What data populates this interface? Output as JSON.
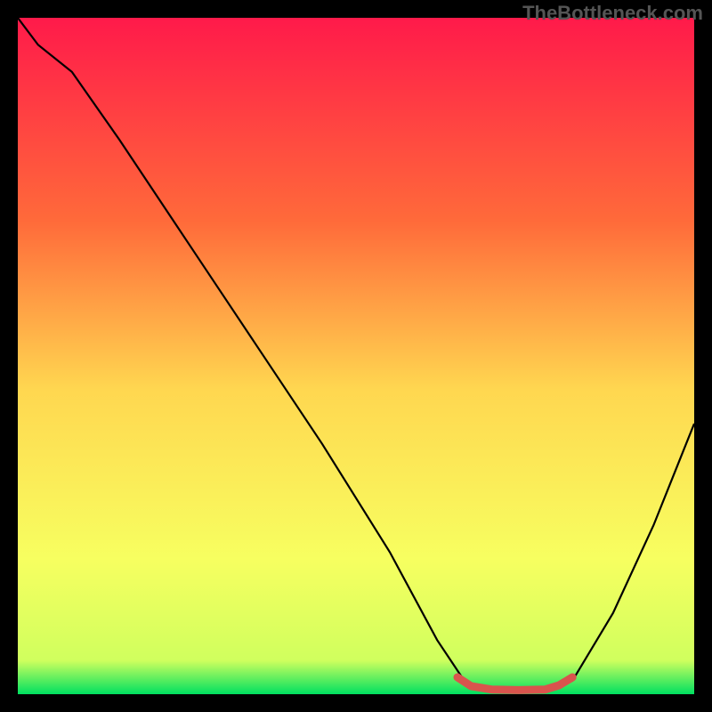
{
  "watermark": "TheBottleneck.com",
  "chart_data": {
    "type": "line",
    "title": "",
    "xlabel": "",
    "ylabel": "",
    "xlim": [
      0,
      100
    ],
    "ylim": [
      0,
      100
    ],
    "gradient_stops": [
      {
        "offset": 0,
        "color": "#ff1a4a"
      },
      {
        "offset": 30,
        "color": "#ff6a3a"
      },
      {
        "offset": 55,
        "color": "#ffd750"
      },
      {
        "offset": 80,
        "color": "#f7ff60"
      },
      {
        "offset": 95,
        "color": "#d0ff5e"
      },
      {
        "offset": 100,
        "color": "#00e060"
      }
    ],
    "series": [
      {
        "name": "bottleneck-curve",
        "color": "#000000",
        "points": [
          {
            "x": 0,
            "y": 100
          },
          {
            "x": 3,
            "y": 96
          },
          {
            "x": 8,
            "y": 92
          },
          {
            "x": 15,
            "y": 82
          },
          {
            "x": 25,
            "y": 67
          },
          {
            "x": 35,
            "y": 52
          },
          {
            "x": 45,
            "y": 37
          },
          {
            "x": 55,
            "y": 21
          },
          {
            "x": 62,
            "y": 8
          },
          {
            "x": 66,
            "y": 2
          },
          {
            "x": 70,
            "y": 0.5
          },
          {
            "x": 78,
            "y": 0.5
          },
          {
            "x": 82,
            "y": 2
          },
          {
            "x": 88,
            "y": 12
          },
          {
            "x": 94,
            "y": 25
          },
          {
            "x": 100,
            "y": 40
          }
        ]
      },
      {
        "name": "optimal-marker",
        "color": "#d9544d",
        "points": [
          {
            "x": 65,
            "y": 2.5
          },
          {
            "x": 67,
            "y": 1.2
          },
          {
            "x": 70,
            "y": 0.7
          },
          {
            "x": 74,
            "y": 0.6
          },
          {
            "x": 78,
            "y": 0.7
          },
          {
            "x": 80,
            "y": 1.3
          },
          {
            "x": 82,
            "y": 2.5
          }
        ]
      }
    ]
  }
}
